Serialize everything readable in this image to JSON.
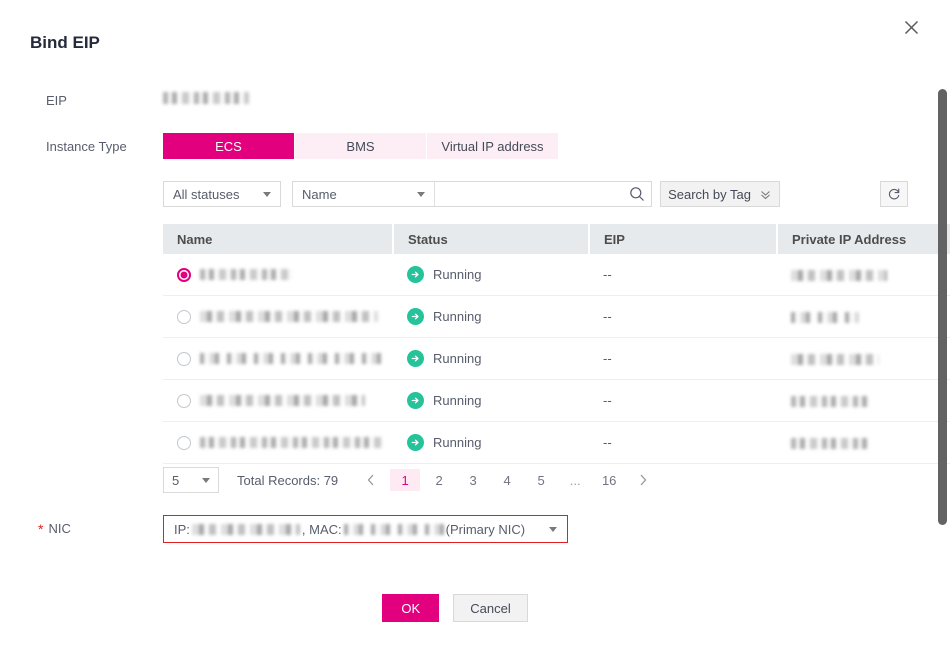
{
  "dialog": {
    "title": "Bind EIP",
    "close_icon": "close-icon"
  },
  "form": {
    "eip": {
      "label": "EIP",
      "value": "",
      "redacted": true
    },
    "instance_type": {
      "label": "Instance Type",
      "tabs": [
        {
          "label": "ECS",
          "active": true
        },
        {
          "label": "BMS",
          "active": false
        },
        {
          "label": "Virtual IP address",
          "active": false
        }
      ]
    },
    "nic": {
      "label": "NIC",
      "required": true,
      "value_prefix": "IP: ",
      "value_mid": ", MAC: ",
      "value_suffix": "(Primary NIC)",
      "error_state": true
    }
  },
  "filters": {
    "status_filter": {
      "value": "All statuses",
      "icon": "chevron-down-icon"
    },
    "search_field": {
      "value": "Name",
      "icon": "chevron-down-icon"
    },
    "search_input": {
      "value": "",
      "placeholder": ""
    },
    "search_icon": "search-icon",
    "tag_search": {
      "label": "Search by Tag",
      "icon": "double-chevron-down-icon"
    },
    "refresh": {
      "icon": "refresh-icon"
    }
  },
  "table": {
    "columns": [
      "Name",
      "Status",
      "EIP",
      "Private IP Address"
    ],
    "rows": [
      {
        "selected": true,
        "name": "",
        "status": "Running",
        "eip": "--",
        "private_ip": ""
      },
      {
        "selected": false,
        "name": "",
        "status": "Running",
        "eip": "--",
        "private_ip": ""
      },
      {
        "selected": false,
        "name": "",
        "status": "Running",
        "eip": "--",
        "private_ip": ""
      },
      {
        "selected": false,
        "name": "",
        "status": "Running",
        "eip": "--",
        "private_ip": ""
      },
      {
        "selected": false,
        "name": "",
        "status": "Running",
        "eip": "--",
        "private_ip": ""
      }
    ]
  },
  "pagination": {
    "page_size": "5",
    "total_records_label": "Total Records: 79",
    "prev_icon": "chevron-left-icon",
    "next_icon": "chevron-right-icon",
    "pages": [
      "1",
      "2",
      "3",
      "4",
      "5",
      "...",
      "16"
    ],
    "active_page": "1"
  },
  "footer": {
    "ok_label": "OK",
    "cancel_label": "Cancel"
  },
  "colors": {
    "accent": "#e3007f",
    "accent_light": "#fdeef5",
    "status_running": "#26c39b",
    "error": "#e02020",
    "table_header": "#e7eaec"
  }
}
